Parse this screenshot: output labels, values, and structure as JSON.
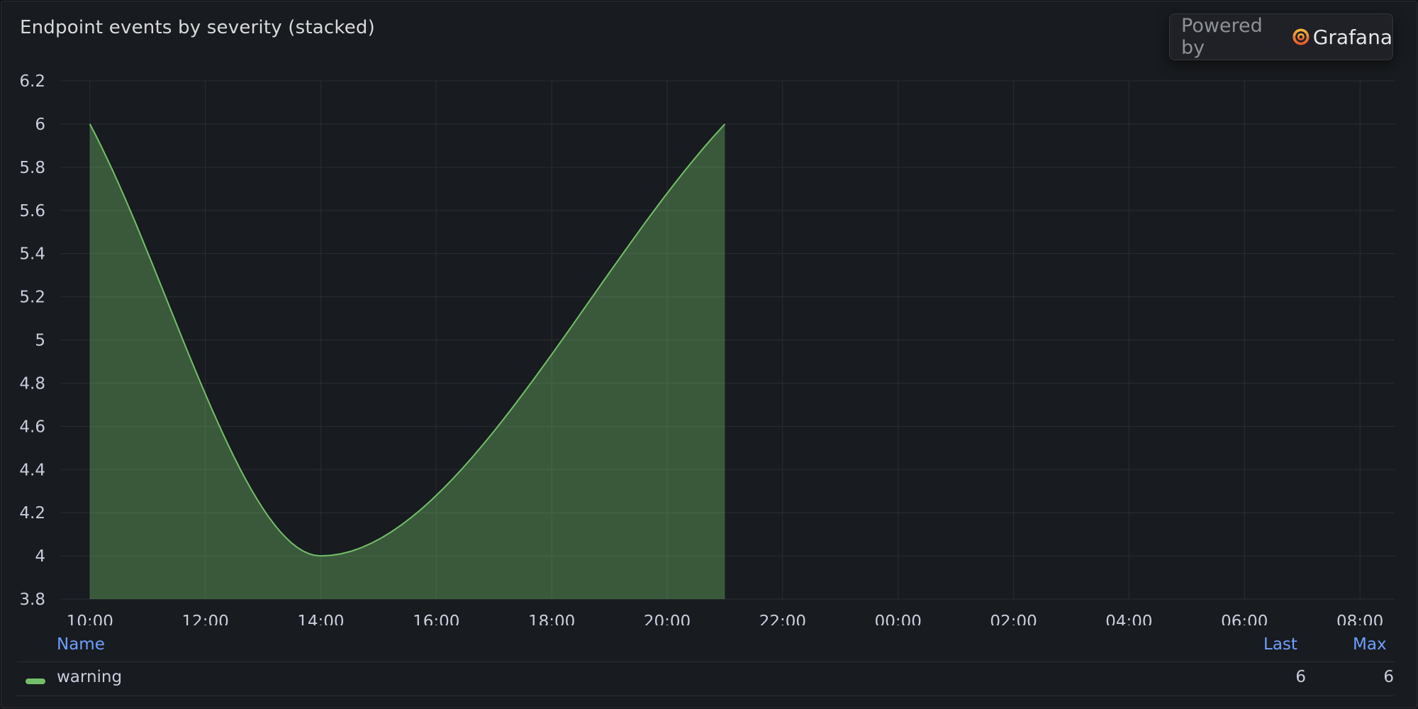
{
  "panel": {
    "title": "Endpoint events by severity (stacked)"
  },
  "badge": {
    "prefix": "Powered by",
    "brand": "Grafana",
    "logo_icon": "grafana-logo-icon"
  },
  "legend": {
    "headers": {
      "name": "Name",
      "last": "Last",
      "max": "Max"
    },
    "rows": [
      {
        "name": "warning",
        "last": "6",
        "max": "6"
      }
    ]
  },
  "colors": {
    "series_line": "#73bf69",
    "series_fill": "#73bf69",
    "grid": "#2a2d33",
    "header_accent": "#6e9fff"
  },
  "chart_data": {
    "type": "area",
    "title": "Endpoint events by severity (stacked)",
    "xlabel": "",
    "ylabel": "",
    "x_ticks": [
      "10:00",
      "12:00",
      "14:00",
      "16:00",
      "18:00",
      "20:00",
      "22:00",
      "00:00",
      "02:00",
      "04:00",
      "06:00",
      "08:00"
    ],
    "x_range_hours": [
      9.5,
      32.6
    ],
    "y_ticks": [
      3.8,
      4,
      4.2,
      4.4,
      4.6,
      4.8,
      5,
      5.2,
      5.4,
      5.6,
      5.8,
      6,
      6.2
    ],
    "ylim": [
      3.8,
      6.2
    ],
    "grid": true,
    "legend_placement": "bottom",
    "stacked": true,
    "series": [
      {
        "name": "warning",
        "color": "#73bf69",
        "x": [
          "10:00",
          "14:00",
          "21:00"
        ],
        "x_hours": [
          10,
          14,
          21
        ],
        "values": [
          6,
          4,
          6
        ]
      }
    ]
  }
}
